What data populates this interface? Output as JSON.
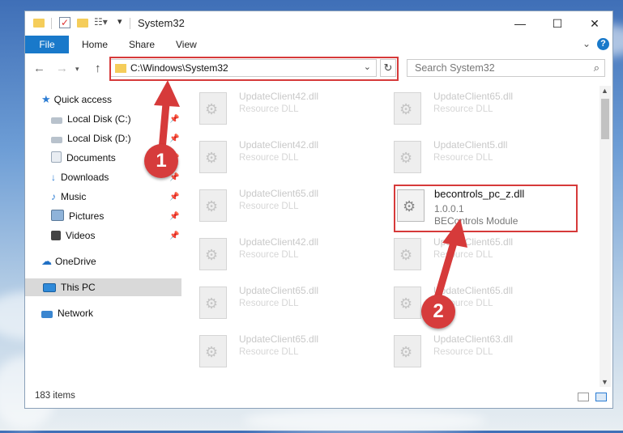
{
  "window": {
    "title": "System32",
    "controls": {
      "minimize": "—",
      "maximize": "☐",
      "close": "✕"
    }
  },
  "ribbon": {
    "tabs": [
      "File",
      "Home",
      "Share",
      "View"
    ],
    "expand": "⌄",
    "help": "?"
  },
  "address_bar": {
    "path": "C:\\Windows\\System32",
    "search_placeholder": "Search System32"
  },
  "nav_pane": {
    "items": [
      {
        "label": "Quick access",
        "icon": "star-icon"
      },
      {
        "label": "Local Disk (C:)",
        "icon": "drive-icon",
        "pinned": true
      },
      {
        "label": "Local Disk (D:)",
        "icon": "drive-icon",
        "pinned": true
      },
      {
        "label": "Documents",
        "icon": "documents-icon",
        "pinned": true
      },
      {
        "label": "Downloads",
        "icon": "downloads-icon",
        "pinned": true
      },
      {
        "label": "Music",
        "icon": "music-icon",
        "pinned": true
      },
      {
        "label": "Pictures",
        "icon": "pictures-icon",
        "pinned": true
      },
      {
        "label": "Videos",
        "icon": "videos-icon",
        "pinned": true
      },
      {
        "label": "OneDrive",
        "icon": "onedrive-icon"
      },
      {
        "label": "This PC",
        "icon": "this-pc-icon",
        "selected": true
      },
      {
        "label": "Network",
        "icon": "network-icon"
      }
    ]
  },
  "files": {
    "left_column": [
      {
        "name": "UpdateClient42.dll",
        "type": "Resource DLL"
      },
      {
        "name": "UpdateClient42.dll",
        "type": "Resource DLL"
      },
      {
        "name": "UpdateClient65.dll",
        "type": "Resource DLL"
      },
      {
        "name": "UpdateClient42.dll",
        "type": "Resource DLL"
      },
      {
        "name": "UpdateClient65.dll",
        "type": "Resource DLL"
      },
      {
        "name": "UpdateClient65.dll",
        "type": "Resource DLL"
      }
    ],
    "right_column": [
      {
        "name": "UpdateClient65.dll",
        "type": "Resource DLL"
      },
      {
        "name": "UpdateClient5.dll",
        "type": "Resource DLL"
      },
      {
        "name": "UpdateClient65.dll",
        "type": "Resource DLL"
      },
      {
        "name": "UpdateClient65.dll",
        "type": "Resource DLL"
      },
      {
        "name": "UpdateClient63.dll",
        "type": "Resource DLL"
      }
    ],
    "highlighted": {
      "name": "becontrols_pc_z.dll",
      "version": "1.0.0.1",
      "description": "BEControls Module"
    }
  },
  "status_bar": {
    "item_count": "183 items"
  },
  "annotations": {
    "step1": "1",
    "step2": "2",
    "color": "#d63a3a"
  }
}
